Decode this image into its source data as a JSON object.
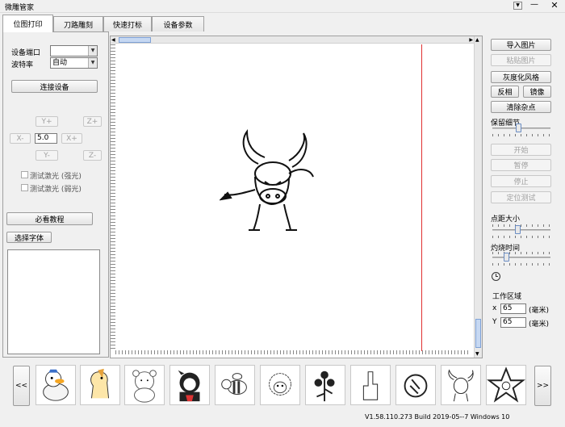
{
  "window": {
    "title": "微雕管家"
  },
  "tabs": [
    {
      "label": "位图打印",
      "active": true
    },
    {
      "label": "刀路雕刻",
      "active": false
    },
    {
      "label": "快速打标",
      "active": false
    },
    {
      "label": "设备参数",
      "active": false
    }
  ],
  "left": {
    "port_label": "设备端口",
    "port_value": "",
    "baud_label": "波特率",
    "baud_value": "自动",
    "connect_button": "连接设备",
    "jog": {
      "y_plus": "Y+",
      "y_minus": "Y-",
      "x_plus": "X+",
      "x_minus": "X-",
      "z_plus": "Z+",
      "z_minus": "Z-",
      "step_value": "5.0"
    },
    "test_strong": "测试激光 (强光)",
    "test_weak": "测试激光 (弱光)",
    "tutorial_button": "必看教程",
    "font_button": "选择字体"
  },
  "right": {
    "import_button": "导入图片",
    "paste_button": "粘贴图片",
    "gray_button": "灰度化风格",
    "invert_button": "反相",
    "mirror_button": "镜像",
    "clean_button": "清除杂点",
    "detail_label": "保留细节",
    "detail_level": 0.45,
    "start_button": "开始",
    "pause_button": "暂停",
    "stop_button": "停止",
    "locate_button": "定位测试",
    "dot_size_label": "点距大小",
    "dot_size_level": 0.43,
    "burn_time_label": "灼烧时间",
    "burn_time_level": 0.22,
    "work_area_label": "工作区域",
    "x_label": "x",
    "x_value": "65",
    "y_label": "Y",
    "y_value": "65",
    "unit_mm": "(毫米)"
  },
  "thumbnails": {
    "prev": "<<",
    "next": ">>",
    "items": [
      {
        "icon": "duck-icon"
      },
      {
        "icon": "horse-icon"
      },
      {
        "icon": "bear-icon"
      },
      {
        "icon": "ninja-girl-icon"
      },
      {
        "icon": "bee-icon"
      },
      {
        "icon": "sheep-icon"
      },
      {
        "icon": "flower-icon"
      },
      {
        "icon": "middle-finger-icon"
      },
      {
        "icon": "pointing-fist-icon"
      },
      {
        "icon": "bull-icon"
      },
      {
        "icon": "star-icon"
      }
    ]
  },
  "status": {
    "build": "V1.58.110.273 Build 2019-05--7 Windows 10"
  }
}
